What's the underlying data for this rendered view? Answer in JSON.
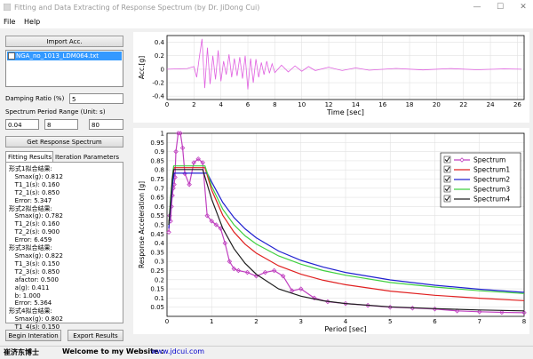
{
  "window": {
    "title": "Fitting and Data Extracting of Response Spectrum (by Dr. JiDong Cui)",
    "min": "—",
    "max": "☐",
    "close": "✕"
  },
  "menu": {
    "file": "File",
    "help": "Help"
  },
  "left": {
    "import_label": "Import Acc.",
    "file_item": "NGA_no_1013_LDM064.txt",
    "damping_label": "Damping Ratio (%)",
    "damping_value": "5",
    "period_label": "Spectrum Period  Range (Unit: s)",
    "period_min": "0.04",
    "period_mid": "8",
    "period_count": "80",
    "get_spectrum_label": "Get Response Spectrum",
    "tab_fitting": "Fitting Results",
    "tab_iteration": "Iteration Parameters",
    "results": [
      "形式1拟合结果:",
      "   Smax(g): 0.812",
      "   T1_1(s): 0.160",
      "   T2_1(s): 0.850",
      "   Error: 5.347",
      "形式2拟合结果:",
      "   Smax(g): 0.782",
      "   T1_2(s): 0.160",
      "   T2_2(s): 0.900",
      "   Error: 6.459",
      "形式3拟合结果:",
      "   Smax(g): 0.822",
      "   T1_3(s): 0.150",
      "   T2_3(s): 0.850",
      "   afactor: 0.500",
      "   a(g): 0.411",
      "   b: 1.000",
      "   Error: 5.364",
      "形式4拟合结果:",
      "   Smax(g): 0.802",
      "   T1_4(s): 0.150"
    ],
    "begin_label": "Begin Interation",
    "export_label": "Export Results"
  },
  "status": {
    "author": "崔济东博士",
    "welcome": "Welcome to my Website :",
    "url": "www.jdcui.com"
  },
  "chart_data": [
    {
      "type": "line",
      "title": "",
      "xlabel": "Time [sec]",
      "ylabel": "Acc.[g]",
      "xlim": [
        0,
        26.5
      ],
      "ylim": [
        -0.45,
        0.5
      ],
      "xticks": [
        0,
        2,
        4,
        6,
        8,
        10,
        12,
        14,
        16,
        18,
        20,
        22,
        24,
        26
      ],
      "yticks": [
        0.4,
        0.2,
        0,
        -0.2,
        -0.4
      ],
      "ytick_labels": [
        "0.4",
        "0.2",
        "0",
        "-0.2",
        "-0.4"
      ],
      "series": [
        {
          "color": "#e060e0",
          "x": [
            0,
            1.5,
            2.0,
            2.2,
            2.4,
            2.6,
            2.8,
            3.0,
            3.2,
            3.4,
            3.6,
            3.8,
            4.0,
            4.2,
            4.4,
            4.6,
            4.8,
            5.0,
            5.2,
            5.4,
            5.6,
            5.8,
            6.0,
            6.2,
            6.4,
            6.6,
            6.8,
            7.0,
            7.2,
            7.4,
            7.6,
            7.8,
            8.0,
            8.5,
            9.0,
            9.5,
            10,
            10.5,
            11,
            12,
            13,
            14,
            15,
            17,
            19,
            21,
            23,
            25,
            26.3
          ],
          "y": [
            0,
            0.01,
            0.04,
            -0.12,
            0.18,
            0.45,
            -0.28,
            0.32,
            -0.22,
            0.2,
            -0.15,
            0.28,
            -0.18,
            0.12,
            -0.08,
            0.22,
            -0.12,
            0.16,
            -0.1,
            0.18,
            -0.14,
            0.2,
            -0.3,
            0.16,
            -0.2,
            0.15,
            -0.12,
            0.1,
            -0.08,
            0.12,
            -0.06,
            0.08,
            -0.05,
            0.06,
            -0.04,
            0.05,
            -0.03,
            0.04,
            -0.02,
            0.03,
            -0.02,
            0.02,
            -0.015,
            0.012,
            -0.01,
            0.01,
            -0.008,
            0.005,
            0
          ]
        }
      ]
    },
    {
      "type": "line",
      "title": "",
      "xlabel": "Period [sec]",
      "ylabel": "Response Acceleration [g]",
      "xlim": [
        0,
        8
      ],
      "ylim": [
        0,
        1.0
      ],
      "xticks": [
        0,
        1,
        2,
        3,
        4,
        5,
        6,
        7,
        8
      ],
      "yticks": [
        0.05,
        0.1,
        0.15,
        0.2,
        0.25,
        0.3,
        0.35,
        0.4,
        0.45,
        0.5,
        0.55,
        0.6,
        0.65,
        0.7,
        0.75,
        0.8,
        0.85,
        0.9,
        0.95,
        1
      ],
      "ytick_labels": [
        "0.05",
        "0.1",
        "0.15",
        "0.2",
        "0.25",
        "0.3",
        "0.35",
        "0.4",
        "0.45",
        "0.5",
        "0.55",
        "0.6",
        "0.65",
        "0.7",
        "0.75",
        "0.8",
        "0.85",
        "0.9",
        "0.95",
        "1"
      ],
      "legend_position": "top-right",
      "series": [
        {
          "name": "Spectrum",
          "color": "#c040c0",
          "marker": "diamond",
          "x": [
            0.04,
            0.06,
            0.08,
            0.1,
            0.12,
            0.14,
            0.16,
            0.18,
            0.2,
            0.25,
            0.3,
            0.35,
            0.4,
            0.5,
            0.6,
            0.7,
            0.8,
            0.9,
            1.0,
            1.1,
            1.2,
            1.3,
            1.4,
            1.5,
            1.6,
            1.8,
            2.0,
            2.2,
            2.4,
            2.6,
            2.8,
            3.0,
            3.3,
            3.6,
            4.0,
            4.5,
            5.0,
            5.5,
            6.0,
            6.5,
            7.0,
            7.5,
            8.0
          ],
          "y": [
            0.46,
            0.55,
            0.52,
            0.6,
            0.66,
            0.7,
            0.72,
            0.76,
            0.9,
            1.0,
            1.02,
            0.92,
            0.78,
            0.72,
            0.84,
            0.86,
            0.84,
            0.55,
            0.52,
            0.5,
            0.48,
            0.4,
            0.3,
            0.26,
            0.25,
            0.24,
            0.22,
            0.24,
            0.25,
            0.22,
            0.14,
            0.15,
            0.1,
            0.08,
            0.07,
            0.06,
            0.05,
            0.045,
            0.04,
            0.03,
            0.025,
            0.022,
            0.02
          ]
        },
        {
          "name": "Spectrum1",
          "color": "#e02020",
          "x": [
            0.04,
            0.08,
            0.12,
            0.16,
            0.3,
            0.5,
            0.7,
            0.85,
            1.0,
            1.25,
            1.5,
            1.75,
            2.0,
            2.5,
            3.0,
            3.5,
            4.0,
            5.0,
            6.0,
            7.0,
            8.0
          ],
          "y": [
            0.5,
            0.62,
            0.74,
            0.812,
            0.812,
            0.812,
            0.812,
            0.812,
            0.69,
            0.552,
            0.46,
            0.394,
            0.345,
            0.276,
            0.23,
            0.197,
            0.173,
            0.138,
            0.115,
            0.099,
            0.086
          ]
        },
        {
          "name": "Spectrum2",
          "color": "#2020d0",
          "x": [
            0.04,
            0.08,
            0.12,
            0.16,
            0.3,
            0.5,
            0.7,
            0.9,
            1.0,
            1.25,
            1.5,
            1.75,
            2.0,
            2.5,
            3.0,
            3.5,
            4.0,
            5.0,
            6.0,
            7.0,
            8.0
          ],
          "y": [
            0.48,
            0.6,
            0.71,
            0.782,
            0.782,
            0.782,
            0.782,
            0.782,
            0.734,
            0.622,
            0.54,
            0.478,
            0.429,
            0.357,
            0.306,
            0.269,
            0.24,
            0.199,
            0.17,
            0.148,
            0.131
          ]
        },
        {
          "name": "Spectrum3",
          "color": "#40d040",
          "x": [
            0.04,
            0.08,
            0.12,
            0.15,
            0.3,
            0.5,
            0.7,
            0.85,
            1.0,
            1.25,
            1.5,
            1.75,
            2.0,
            2.5,
            3.0,
            3.5,
            4.0,
            5.0,
            6.0,
            7.0,
            8.0
          ],
          "y": [
            0.5,
            0.64,
            0.76,
            0.822,
            0.822,
            0.822,
            0.822,
            0.822,
            0.71,
            0.585,
            0.5,
            0.44,
            0.395,
            0.33,
            0.285,
            0.25,
            0.225,
            0.185,
            0.16,
            0.14,
            0.125
          ]
        },
        {
          "name": "Spectrum4",
          "color": "#202020",
          "x": [
            0.04,
            0.08,
            0.12,
            0.15,
            0.3,
            0.5,
            0.7,
            0.8,
            1.0,
            1.25,
            1.5,
            1.75,
            2.0,
            2.5,
            3.0,
            3.5,
            4.0,
            5.0,
            6.0,
            7.0,
            8.0
          ],
          "y": [
            0.5,
            0.62,
            0.75,
            0.802,
            0.802,
            0.802,
            0.802,
            0.802,
            0.64,
            0.48,
            0.37,
            0.29,
            0.23,
            0.15,
            0.11,
            0.085,
            0.07,
            0.052,
            0.042,
            0.035,
            0.03
          ]
        }
      ]
    }
  ]
}
